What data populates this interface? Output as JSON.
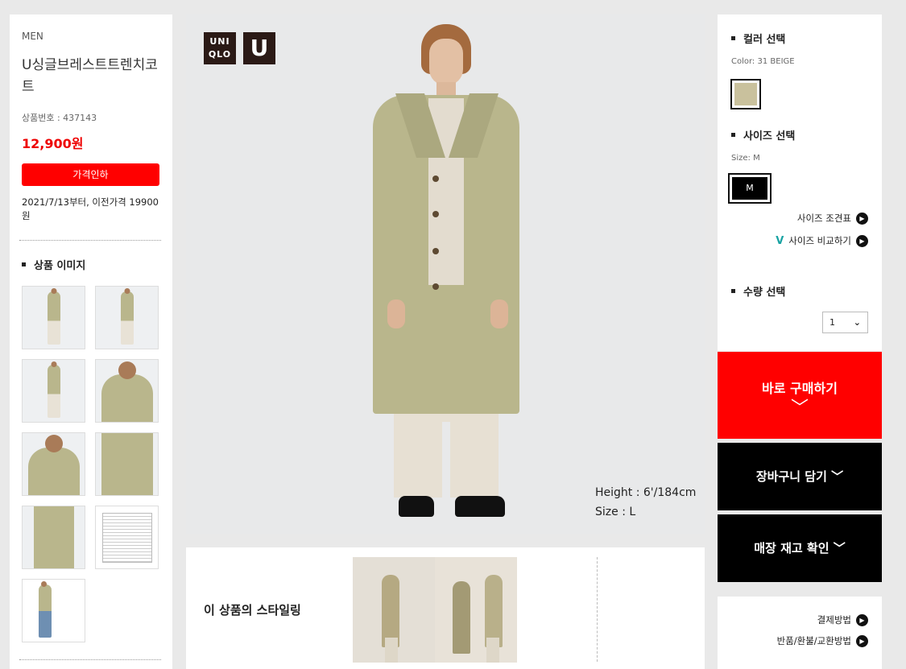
{
  "product": {
    "category": "MEN",
    "name": "U싱글브레스트트렌치코트",
    "number_label": "상품번호 : 437143",
    "price": "12,900원",
    "discount_button": "가격인하",
    "previous_price_note": "2021/7/13부터, 이전가격 19900원",
    "image_section_title": "상품 이미지"
  },
  "main_image": {
    "logo_uniqlo": "UNI QLO",
    "logo_u": "U",
    "caption_height": "Height : 6'/184cm",
    "caption_size": "Size : L"
  },
  "styling": {
    "title": "이 상품의 스타일링"
  },
  "options": {
    "color_title": "컬러 선택",
    "color_value": "Color: 31 BEIGE",
    "color_swatch_hex": "#c9c19d",
    "size_title": "사이즈 선택",
    "size_value": "Size: M",
    "size_selected": "M",
    "size_chart_link": "사이즈 조견표",
    "size_compare_link": "사이즈 비교하기",
    "quantity_title": "수량 선택",
    "quantity_selected": "1"
  },
  "actions": {
    "buy_now": "바로 구매하기",
    "add_to_cart": "장바구니 담기",
    "store_stock": "매장 재고 확인"
  },
  "info_links": {
    "payment": "결제방법",
    "returns": "반품/환불/교환방법"
  },
  "colors": {
    "accent_red": "#ff0000",
    "price_red": "#e00000",
    "black": "#000000"
  }
}
